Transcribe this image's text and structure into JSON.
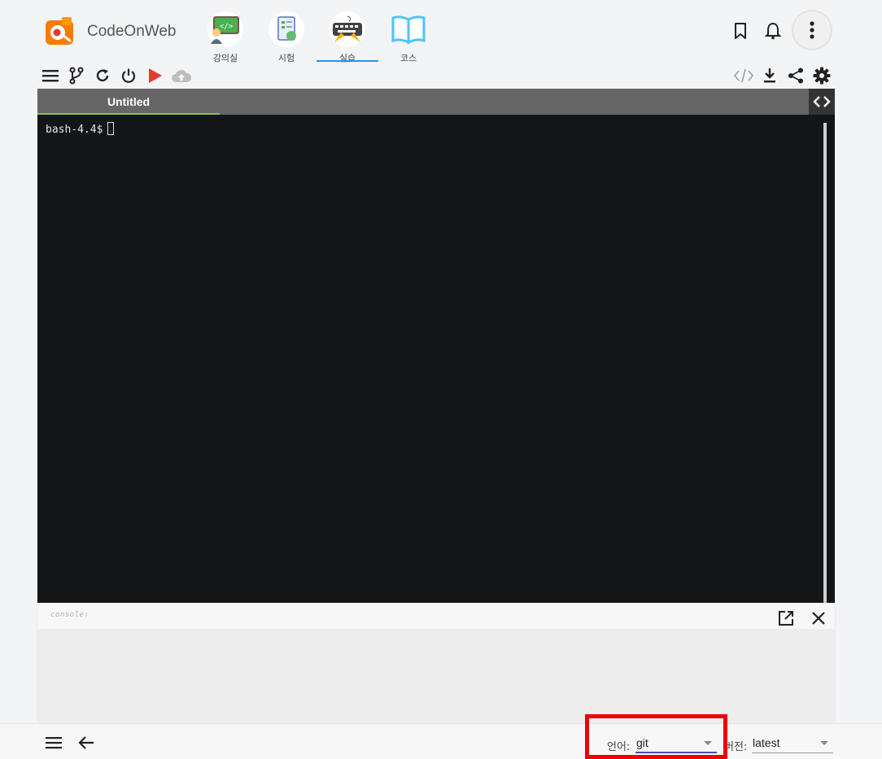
{
  "brand": {
    "name": "CodeOnWeb"
  },
  "nav": {
    "items": [
      {
        "label": "강의실",
        "icon": "classroom-icon"
      },
      {
        "label": "시험",
        "icon": "exam-icon"
      },
      {
        "label": "실습",
        "icon": "practice-keyboard-icon",
        "active": true
      },
      {
        "label": "코스",
        "icon": "course-book-icon"
      }
    ]
  },
  "header_icons": [
    "bookmark-icon",
    "bell-icon",
    "more-vert-icon"
  ],
  "toolbar": {
    "left": [
      "menu-icon",
      "branch-icon",
      "refresh-icon",
      "power-icon",
      "run-icon",
      "upload-cloud-icon"
    ],
    "right": [
      "code-icon",
      "download-icon",
      "share-icon",
      "settings-icon"
    ]
  },
  "editor": {
    "tab_label": "Untitled",
    "terminal_prompt": "bash-4.4$"
  },
  "console": {
    "label": "console:"
  },
  "bottom": {
    "language_label": "언어:",
    "language_value": "git",
    "version_label": "버전:",
    "version_value": "latest"
  },
  "colors": {
    "accent_blue": "#2196f3",
    "run_red": "#e53935",
    "tab_underline_green": "#8bc34a",
    "highlight_red": "#ee0000",
    "terminal_bg": "#141517"
  }
}
